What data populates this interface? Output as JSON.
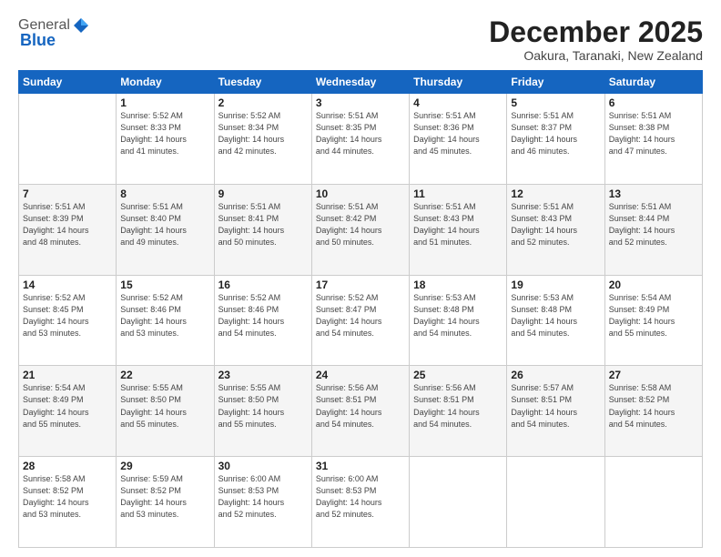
{
  "logo": {
    "general": "General",
    "blue": "Blue"
  },
  "header": {
    "month_year": "December 2025",
    "location": "Oakura, Taranaki, New Zealand"
  },
  "weekdays": [
    "Sunday",
    "Monday",
    "Tuesday",
    "Wednesday",
    "Thursday",
    "Friday",
    "Saturday"
  ],
  "weeks": [
    [
      {
        "day": "",
        "info": ""
      },
      {
        "day": "1",
        "info": "Sunrise: 5:52 AM\nSunset: 8:33 PM\nDaylight: 14 hours\nand 41 minutes."
      },
      {
        "day": "2",
        "info": "Sunrise: 5:52 AM\nSunset: 8:34 PM\nDaylight: 14 hours\nand 42 minutes."
      },
      {
        "day": "3",
        "info": "Sunrise: 5:51 AM\nSunset: 8:35 PM\nDaylight: 14 hours\nand 44 minutes."
      },
      {
        "day": "4",
        "info": "Sunrise: 5:51 AM\nSunset: 8:36 PM\nDaylight: 14 hours\nand 45 minutes."
      },
      {
        "day": "5",
        "info": "Sunrise: 5:51 AM\nSunset: 8:37 PM\nDaylight: 14 hours\nand 46 minutes."
      },
      {
        "day": "6",
        "info": "Sunrise: 5:51 AM\nSunset: 8:38 PM\nDaylight: 14 hours\nand 47 minutes."
      }
    ],
    [
      {
        "day": "7",
        "info": "Sunrise: 5:51 AM\nSunset: 8:39 PM\nDaylight: 14 hours\nand 48 minutes."
      },
      {
        "day": "8",
        "info": "Sunrise: 5:51 AM\nSunset: 8:40 PM\nDaylight: 14 hours\nand 49 minutes."
      },
      {
        "day": "9",
        "info": "Sunrise: 5:51 AM\nSunset: 8:41 PM\nDaylight: 14 hours\nand 50 minutes."
      },
      {
        "day": "10",
        "info": "Sunrise: 5:51 AM\nSunset: 8:42 PM\nDaylight: 14 hours\nand 50 minutes."
      },
      {
        "day": "11",
        "info": "Sunrise: 5:51 AM\nSunset: 8:43 PM\nDaylight: 14 hours\nand 51 minutes."
      },
      {
        "day": "12",
        "info": "Sunrise: 5:51 AM\nSunset: 8:43 PM\nDaylight: 14 hours\nand 52 minutes."
      },
      {
        "day": "13",
        "info": "Sunrise: 5:51 AM\nSunset: 8:44 PM\nDaylight: 14 hours\nand 52 minutes."
      }
    ],
    [
      {
        "day": "14",
        "info": "Sunrise: 5:52 AM\nSunset: 8:45 PM\nDaylight: 14 hours\nand 53 minutes."
      },
      {
        "day": "15",
        "info": "Sunrise: 5:52 AM\nSunset: 8:46 PM\nDaylight: 14 hours\nand 53 minutes."
      },
      {
        "day": "16",
        "info": "Sunrise: 5:52 AM\nSunset: 8:46 PM\nDaylight: 14 hours\nand 54 minutes."
      },
      {
        "day": "17",
        "info": "Sunrise: 5:52 AM\nSunset: 8:47 PM\nDaylight: 14 hours\nand 54 minutes."
      },
      {
        "day": "18",
        "info": "Sunrise: 5:53 AM\nSunset: 8:48 PM\nDaylight: 14 hours\nand 54 minutes."
      },
      {
        "day": "19",
        "info": "Sunrise: 5:53 AM\nSunset: 8:48 PM\nDaylight: 14 hours\nand 54 minutes."
      },
      {
        "day": "20",
        "info": "Sunrise: 5:54 AM\nSunset: 8:49 PM\nDaylight: 14 hours\nand 55 minutes."
      }
    ],
    [
      {
        "day": "21",
        "info": "Sunrise: 5:54 AM\nSunset: 8:49 PM\nDaylight: 14 hours\nand 55 minutes."
      },
      {
        "day": "22",
        "info": "Sunrise: 5:55 AM\nSunset: 8:50 PM\nDaylight: 14 hours\nand 55 minutes."
      },
      {
        "day": "23",
        "info": "Sunrise: 5:55 AM\nSunset: 8:50 PM\nDaylight: 14 hours\nand 55 minutes."
      },
      {
        "day": "24",
        "info": "Sunrise: 5:56 AM\nSunset: 8:51 PM\nDaylight: 14 hours\nand 54 minutes."
      },
      {
        "day": "25",
        "info": "Sunrise: 5:56 AM\nSunset: 8:51 PM\nDaylight: 14 hours\nand 54 minutes."
      },
      {
        "day": "26",
        "info": "Sunrise: 5:57 AM\nSunset: 8:51 PM\nDaylight: 14 hours\nand 54 minutes."
      },
      {
        "day": "27",
        "info": "Sunrise: 5:58 AM\nSunset: 8:52 PM\nDaylight: 14 hours\nand 54 minutes."
      }
    ],
    [
      {
        "day": "28",
        "info": "Sunrise: 5:58 AM\nSunset: 8:52 PM\nDaylight: 14 hours\nand 53 minutes."
      },
      {
        "day": "29",
        "info": "Sunrise: 5:59 AM\nSunset: 8:52 PM\nDaylight: 14 hours\nand 53 minutes."
      },
      {
        "day": "30",
        "info": "Sunrise: 6:00 AM\nSunset: 8:53 PM\nDaylight: 14 hours\nand 52 minutes."
      },
      {
        "day": "31",
        "info": "Sunrise: 6:00 AM\nSunset: 8:53 PM\nDaylight: 14 hours\nand 52 minutes."
      },
      {
        "day": "",
        "info": ""
      },
      {
        "day": "",
        "info": ""
      },
      {
        "day": "",
        "info": ""
      }
    ]
  ]
}
